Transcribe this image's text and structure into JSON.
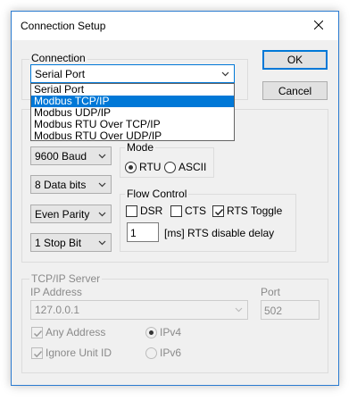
{
  "window": {
    "title": "Connection Setup"
  },
  "connection": {
    "group_label": "Connection",
    "selected": "Serial Port",
    "options": [
      "Serial Port",
      "Modbus TCP/IP",
      "Modbus UDP/IP",
      "Modbus RTU Over TCP/IP",
      "Modbus RTU Over UDP/IP"
    ],
    "highlighted_option": "Modbus TCP/IP"
  },
  "buttons": {
    "ok": "OK",
    "cancel": "Cancel"
  },
  "serial": {
    "baud": "9600 Baud",
    "data_bits": "8 Data bits",
    "parity": "Even Parity",
    "stop_bits": "1 Stop Bit"
  },
  "mode": {
    "label": "Mode",
    "rtu": "RTU",
    "ascii": "ASCII",
    "selected": "RTU"
  },
  "flow_control": {
    "label": "Flow Control",
    "dsr": "DSR",
    "dsr_checked": false,
    "cts": "CTS",
    "cts_checked": false,
    "rts_toggle": "RTS Toggle",
    "rts_toggle_checked": true,
    "rts_delay_value": "1",
    "rts_delay_label": "[ms] RTS disable delay"
  },
  "tcpip": {
    "group_label": "TCP/IP Server",
    "ip_label": "IP Address",
    "ip_value": "127.0.0.1",
    "port_label": "Port",
    "port_value": "502",
    "any_address": "Any Address",
    "any_address_checked": true,
    "ignore_unit_id": "Ignore Unit ID",
    "ignore_unit_id_checked": true,
    "ipv4": "IPv4",
    "ipv6": "IPv6",
    "ip_version_selected": "IPv4"
  },
  "colors": {
    "accent": "#0078d7",
    "disabled_text": "#8a8a8a",
    "window_bg": "#f0f0f0"
  }
}
